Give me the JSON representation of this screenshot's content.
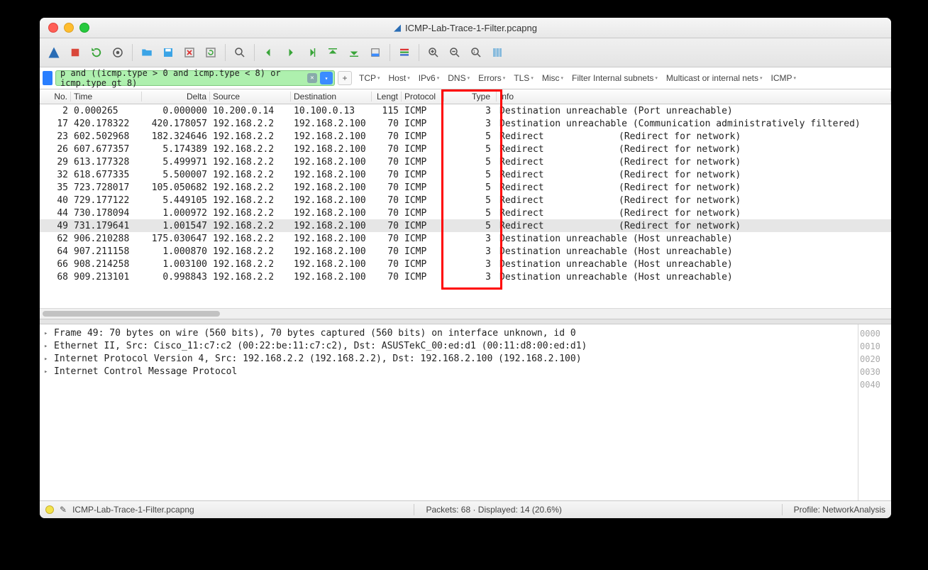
{
  "title": "ICMP-Lab-Trace-1-Filter.pcapng",
  "filter_text": "p and ((icmp.type > 0 and icmp.type < 8) or icmp.type gt 8)",
  "filter_buttons": [
    "TCP",
    "Host",
    "IPv6",
    "DNS",
    "Errors",
    "TLS",
    "Misc",
    "Filter Internal subnets",
    "Multicast or internal nets",
    "ICMP"
  ],
  "columns": [
    "No.",
    "Time",
    "Delta",
    "Source",
    "Destination",
    "Lengt",
    "Protocol",
    "Type",
    "Info"
  ],
  "packets": [
    {
      "no": "2",
      "time": "0.000265",
      "delta": "0.000000",
      "src": "10.200.0.14",
      "dst": "10.100.0.13",
      "len": "115",
      "proto": "ICMP",
      "type": "3",
      "info_a": "Destination unreachable (Port unreachable)",
      "info_b": ""
    },
    {
      "no": "17",
      "time": "420.178322",
      "delta": "420.178057",
      "src": "192.168.2.2",
      "dst": "192.168.2.100",
      "len": "70",
      "proto": "ICMP",
      "type": "3",
      "info_a": "Destination unreachable (Communication administratively filtered)",
      "info_b": ""
    },
    {
      "no": "23",
      "time": "602.502968",
      "delta": "182.324646",
      "src": "192.168.2.2",
      "dst": "192.168.2.100",
      "len": "70",
      "proto": "ICMP",
      "type": "5",
      "info_a": "Redirect",
      "info_b": "(Redirect for network)"
    },
    {
      "no": "26",
      "time": "607.677357",
      "delta": "5.174389",
      "src": "192.168.2.2",
      "dst": "192.168.2.100",
      "len": "70",
      "proto": "ICMP",
      "type": "5",
      "info_a": "Redirect",
      "info_b": "(Redirect for network)"
    },
    {
      "no": "29",
      "time": "613.177328",
      "delta": "5.499971",
      "src": "192.168.2.2",
      "dst": "192.168.2.100",
      "len": "70",
      "proto": "ICMP",
      "type": "5",
      "info_a": "Redirect",
      "info_b": "(Redirect for network)"
    },
    {
      "no": "32",
      "time": "618.677335",
      "delta": "5.500007",
      "src": "192.168.2.2",
      "dst": "192.168.2.100",
      "len": "70",
      "proto": "ICMP",
      "type": "5",
      "info_a": "Redirect",
      "info_b": "(Redirect for network)"
    },
    {
      "no": "35",
      "time": "723.728017",
      "delta": "105.050682",
      "src": "192.168.2.2",
      "dst": "192.168.2.100",
      "len": "70",
      "proto": "ICMP",
      "type": "5",
      "info_a": "Redirect",
      "info_b": "(Redirect for network)"
    },
    {
      "no": "40",
      "time": "729.177122",
      "delta": "5.449105",
      "src": "192.168.2.2",
      "dst": "192.168.2.100",
      "len": "70",
      "proto": "ICMP",
      "type": "5",
      "info_a": "Redirect",
      "info_b": "(Redirect for network)"
    },
    {
      "no": "44",
      "time": "730.178094",
      "delta": "1.000972",
      "src": "192.168.2.2",
      "dst": "192.168.2.100",
      "len": "70",
      "proto": "ICMP",
      "type": "5",
      "info_a": "Redirect",
      "info_b": "(Redirect for network)"
    },
    {
      "no": "49",
      "time": "731.179641",
      "delta": "1.001547",
      "src": "192.168.2.2",
      "dst": "192.168.2.100",
      "len": "70",
      "proto": "ICMP",
      "type": "5",
      "info_a": "Redirect",
      "info_b": "(Redirect for network)",
      "sel": true
    },
    {
      "no": "62",
      "time": "906.210288",
      "delta": "175.030647",
      "src": "192.168.2.2",
      "dst": "192.168.2.100",
      "len": "70",
      "proto": "ICMP",
      "type": "3",
      "info_a": "Destination unreachable (Host unreachable)",
      "info_b": ""
    },
    {
      "no": "64",
      "time": "907.211158",
      "delta": "1.000870",
      "src": "192.168.2.2",
      "dst": "192.168.2.100",
      "len": "70",
      "proto": "ICMP",
      "type": "3",
      "info_a": "Destination unreachable (Host unreachable)",
      "info_b": ""
    },
    {
      "no": "66",
      "time": "908.214258",
      "delta": "1.003100",
      "src": "192.168.2.2",
      "dst": "192.168.2.100",
      "len": "70",
      "proto": "ICMP",
      "type": "3",
      "info_a": "Destination unreachable (Host unreachable)",
      "info_b": ""
    },
    {
      "no": "68",
      "time": "909.213101",
      "delta": "0.998843",
      "src": "192.168.2.2",
      "dst": "192.168.2.100",
      "len": "70",
      "proto": "ICMP",
      "type": "3",
      "info_a": "Destination unreachable (Host unreachable)",
      "info_b": ""
    }
  ],
  "tree": [
    "Frame 49: 70 bytes on wire (560 bits), 70 bytes captured (560 bits) on interface unknown, id 0",
    "Ethernet II, Src: Cisco_11:c7:c2 (00:22:be:11:c7:c2), Dst: ASUSTekC_00:ed:d1 (00:11:d8:00:ed:d1)",
    "Internet Protocol Version 4, Src: 192.168.2.2 (192.168.2.2), Dst: 192.168.2.100 (192.168.2.100)",
    "Internet Control Message Protocol"
  ],
  "hex_offsets": [
    "0000",
    "0010",
    "0020",
    "0030",
    "0040"
  ],
  "status": {
    "file": "ICMP-Lab-Trace-1-Filter.pcapng",
    "packets": "Packets: 68 · Displayed: 14 (20.6%)",
    "profile": "Profile: NetworkAnalysis"
  }
}
